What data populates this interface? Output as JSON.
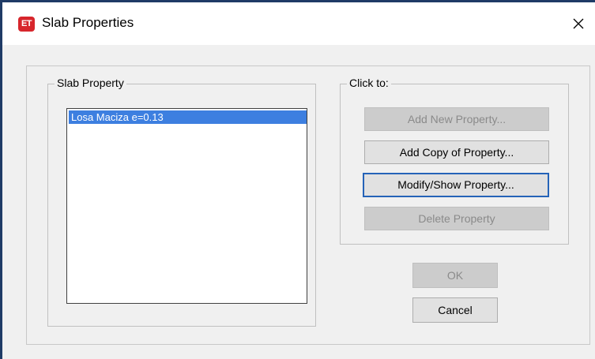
{
  "window": {
    "title": "Slab Properties",
    "app_icon_label": "ET",
    "icon": "close-icon"
  },
  "slab_property_group": {
    "legend": "Slab Property",
    "items": [
      "Losa Maciza e=0.13"
    ],
    "selected": "Losa Maciza e=0.13"
  },
  "click_to_group": {
    "legend": "Click to:",
    "add_new_label": "Add New Property...",
    "add_copy_label": "Add Copy of Property...",
    "modify_label": "Modify/Show Property...",
    "delete_label": "Delete Property"
  },
  "ok_label": "OK",
  "cancel_label": "Cancel",
  "colors": {
    "selection": "#3d7fe0",
    "focus_border": "#2563b8",
    "app_icon": "#d7262c"
  }
}
